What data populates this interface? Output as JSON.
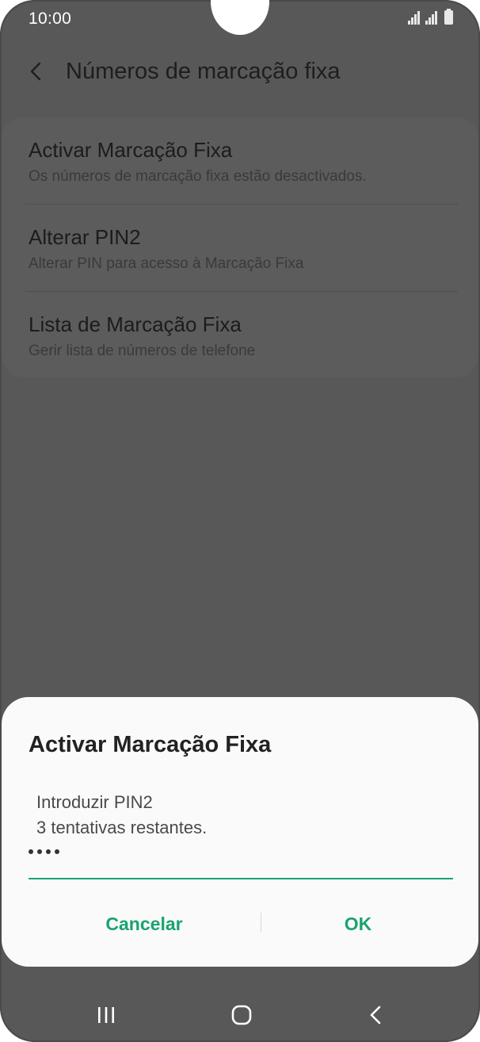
{
  "status_bar": {
    "time": "10:00"
  },
  "header": {
    "title": "Números de marcação fixa"
  },
  "settings": {
    "items": [
      {
        "title": "Activar Marcação Fixa",
        "subtitle": "Os números de marcação fixa estão desactivados."
      },
      {
        "title": "Alterar PIN2",
        "subtitle": "Alterar PIN para acesso à Marcação Fixa"
      },
      {
        "title": "Lista de Marcação Fixa",
        "subtitle": "Gerir lista de números de telefone"
      }
    ]
  },
  "dialog": {
    "title": "Activar Marcação Fixa",
    "message_line1": "Introduzir PIN2",
    "message_line2": "3 tentativas restantes.",
    "pin_length": 4,
    "cancel_label": "Cancelar",
    "ok_label": "OK"
  },
  "colors": {
    "accent": "#1aa36f",
    "scrim_background": "#585858",
    "dialog_background": "#fafafa"
  },
  "icons": {
    "back": "back-arrow-icon",
    "recents": "recents-icon",
    "home": "home-icon",
    "nav_back": "nav-back-icon",
    "signal": "signal-icon",
    "battery": "battery-icon"
  }
}
